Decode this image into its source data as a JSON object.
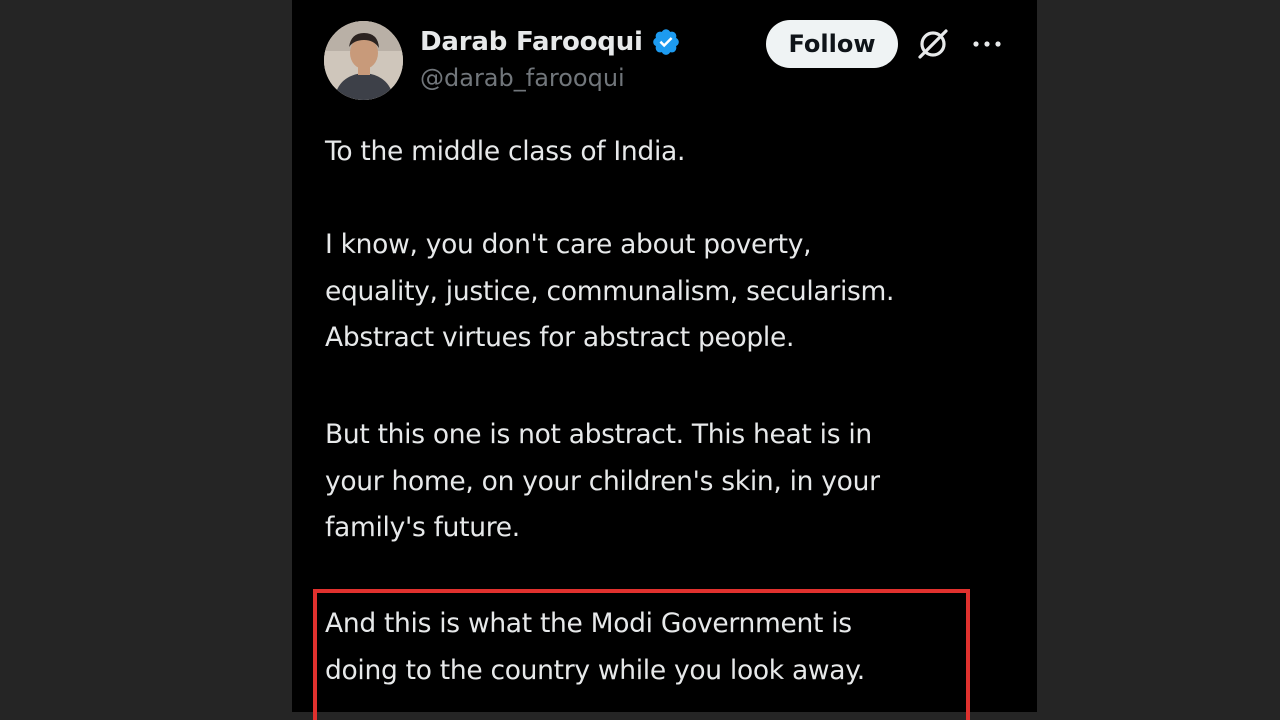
{
  "author": {
    "display_name": "Darab Farooqui",
    "handle": "@darab_farooqui",
    "verified": true,
    "verified_color": "#1d9bf0"
  },
  "actions": {
    "follow_label": "Follow",
    "grok_icon": "grok-icon",
    "more_icon": "more-options-icon"
  },
  "tweet": {
    "paragraph_1": [
      "To the middle class of India."
    ],
    "paragraph_2": [
      "I know, you don't care about poverty,",
      "equality, justice, communalism, secularism.",
      "Abstract virtues for abstract people."
    ],
    "paragraph_3": [
      "But this one is not abstract. This heat is in",
      "your home, on your children's skin, in your",
      "family's future."
    ],
    "paragraph_4": [
      "And this is what the Modi Government is",
      "doing to the country while you look away."
    ]
  },
  "colors": {
    "page_background": "#252525",
    "tweet_background": "#000000",
    "text": "#e7e9ea",
    "handle": "#71767b",
    "highlight_border": "#e0312e"
  }
}
